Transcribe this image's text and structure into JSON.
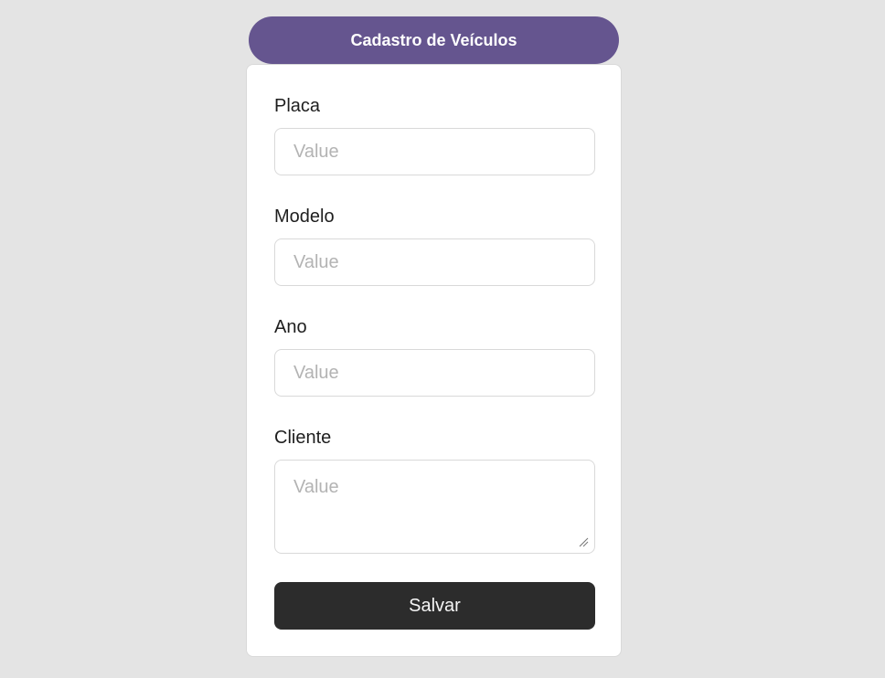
{
  "header": {
    "title": "Cadastro de Veículos"
  },
  "form": {
    "fields": [
      {
        "label": "Placa",
        "value": "",
        "placeholder": "Value"
      },
      {
        "label": "Modelo",
        "value": "",
        "placeholder": "Value"
      },
      {
        "label": "Ano",
        "value": "",
        "placeholder": "Value"
      },
      {
        "label": "Cliente",
        "value": "",
        "placeholder": "Value"
      }
    ],
    "save_label": "Salvar"
  },
  "colors": {
    "header_bg": "#65558f",
    "button_bg": "#2c2c2c",
    "page_bg": "#e4e4e4",
    "placeholder": "#b3b3b3"
  }
}
